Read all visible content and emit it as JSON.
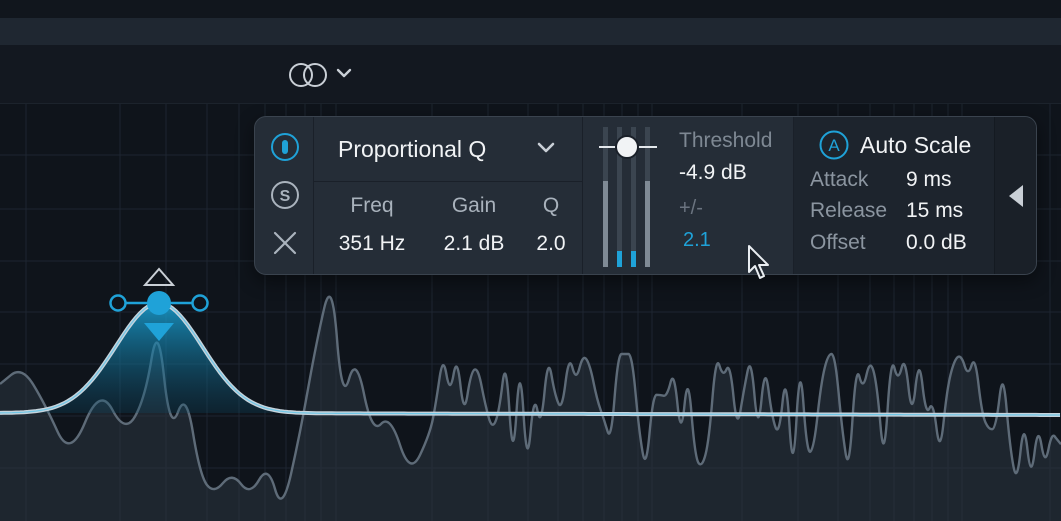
{
  "toolbar": {
    "stereo_icon": "stereo-link-icon",
    "dropdown_icon": "chevron-down-icon"
  },
  "band_panel": {
    "icons": [
      "power-icon",
      "solo-icon",
      "close-icon"
    ],
    "solo_letter": "S",
    "shape": {
      "label": "Proportional Q",
      "icon": "chevron-down-icon"
    },
    "params": [
      {
        "label": "Freq",
        "value": "351 Hz"
      },
      {
        "label": "Gain",
        "value": "2.1 dB"
      },
      {
        "label": "Q",
        "value": "2.0"
      }
    ],
    "threshold": {
      "label": "Threshold",
      "value": "-4.9 dB",
      "pm_label": "+/-",
      "pm_value": "2.1"
    },
    "auto_scale": {
      "letter": "A",
      "label": "Auto Scale",
      "rows": [
        {
          "label": "Attack",
          "value": "9 ms"
        },
        {
          "label": "Release",
          "value": "15 ms"
        },
        {
          "label": "Offset",
          "value": "0.0 dB"
        }
      ]
    },
    "collapse_icon": "triangle-left-icon"
  },
  "colors": {
    "accent": "#1fa2d8",
    "panel_bg": "#252d37",
    "graph_bg": "#0f141b"
  }
}
